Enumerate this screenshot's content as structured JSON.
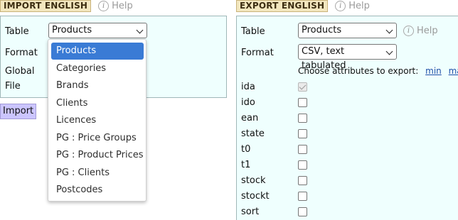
{
  "import": {
    "title": "IMPORT ENGLISH",
    "help": "Help",
    "table_label": "Table",
    "table_value": "Products",
    "format_label": "Format",
    "global_label": "Global",
    "file_label": "File",
    "import_button": "Import",
    "dropdown_options": [
      "Products",
      "Categories",
      "Brands",
      "Clients",
      "Licences",
      "PG : Price Groups",
      "PG : Product Prices",
      "PG : Clients",
      "Postcodes"
    ]
  },
  "export": {
    "title": "EXPORT ENGLISH",
    "help": "Help",
    "table_label": "Table",
    "table_value": "Products",
    "table_help": "Help",
    "format_label": "Format",
    "format_value": "CSV, text tabulated",
    "choose_text": "Choose attributes to export:",
    "min_link": "min",
    "max_link": "max",
    "attributes": [
      {
        "name": "ida",
        "checked": true,
        "disabled": true
      },
      {
        "name": "ido",
        "checked": false,
        "disabled": false
      },
      {
        "name": "ean",
        "checked": false,
        "disabled": false
      },
      {
        "name": "state",
        "checked": false,
        "disabled": false
      },
      {
        "name": "t0",
        "checked": false,
        "disabled": false
      },
      {
        "name": "t1",
        "checked": false,
        "disabled": false
      },
      {
        "name": "stock",
        "checked": false,
        "disabled": false
      },
      {
        "name": "stockt",
        "checked": false,
        "disabled": false
      },
      {
        "name": "sort",
        "checked": false,
        "disabled": false
      }
    ]
  },
  "colors": {
    "panel_bg": "#effffe",
    "section_title_bg": "#f3e7bf",
    "import_button_bg": "#cbc5ff",
    "selected_option_bg": "#3a7bd5",
    "link": "#1f4fa8"
  }
}
